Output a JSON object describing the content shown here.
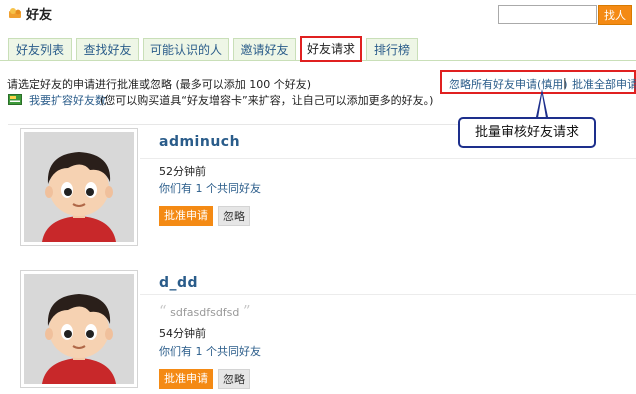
{
  "header": {
    "title": "好友",
    "search_value": "",
    "find_button": "找人"
  },
  "tabs": [
    {
      "label": "好友列表",
      "active": false
    },
    {
      "label": "查找好友",
      "active": false
    },
    {
      "label": "可能认识的人",
      "active": false
    },
    {
      "label": "邀请好友",
      "active": false
    },
    {
      "label": "好友请求",
      "active": true
    },
    {
      "label": "排行榜",
      "active": false
    }
  ],
  "intro": {
    "text": "请选定好友的申请进行批准或忽略 (最多可以添加 100 个好友)",
    "expand_link": "我要扩容好友数",
    "expand_note": "(您可以购买道具“好友增容卡”来扩容，让自己可以添加更多的好友。)"
  },
  "actions": {
    "ignore_all": "忽略所有好友申请(慎用)",
    "separator": "|",
    "approve_all": "批准全部申请",
    "callout": "批量审核好友请求"
  },
  "requests": [
    {
      "username": "adminuch",
      "message": "",
      "time": "52分钟前",
      "mutual": "你们有 1 个共同好友",
      "approve_label": "批准申请",
      "ignore_label": "忽略"
    },
    {
      "username": "d_dd",
      "message": "sdfasdfsdfsd",
      "time": "54分钟前",
      "mutual": "你们有 1 个共同好友",
      "approve_label": "批准申请",
      "ignore_label": "忽略"
    }
  ],
  "colors": {
    "accent_orange": "#f48a14",
    "link_blue": "#2a5c8a",
    "highlight_red": "#e02020",
    "callout_navy": "#1d2f8c",
    "tab_bg": "#eef6e6"
  },
  "icons": {
    "title_icon": "friends-icon",
    "expand_icon": "expand-card-icon",
    "avatar": "cartoon-boy-avatar"
  }
}
